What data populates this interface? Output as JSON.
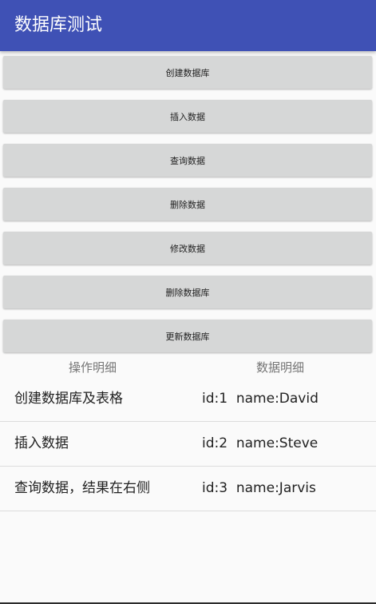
{
  "appbar": {
    "title": "数据库测试"
  },
  "buttons": [
    {
      "label": "创建数据库"
    },
    {
      "label": "插入数据"
    },
    {
      "label": "查询数据"
    },
    {
      "label": "删除数据"
    },
    {
      "label": "修改数据"
    },
    {
      "label": "删除数据库"
    },
    {
      "label": "更新数据库"
    }
  ],
  "columns": {
    "operation": "操作明细",
    "data": "数据明细"
  },
  "rows": [
    {
      "operation": "创建数据库及表格",
      "data": "id:1  name:David"
    },
    {
      "operation": "插入数据",
      "data": "id:2  name:Steve"
    },
    {
      "operation": "查询数据，结果在右侧",
      "data": "id:3  name:Jarvis"
    }
  ]
}
